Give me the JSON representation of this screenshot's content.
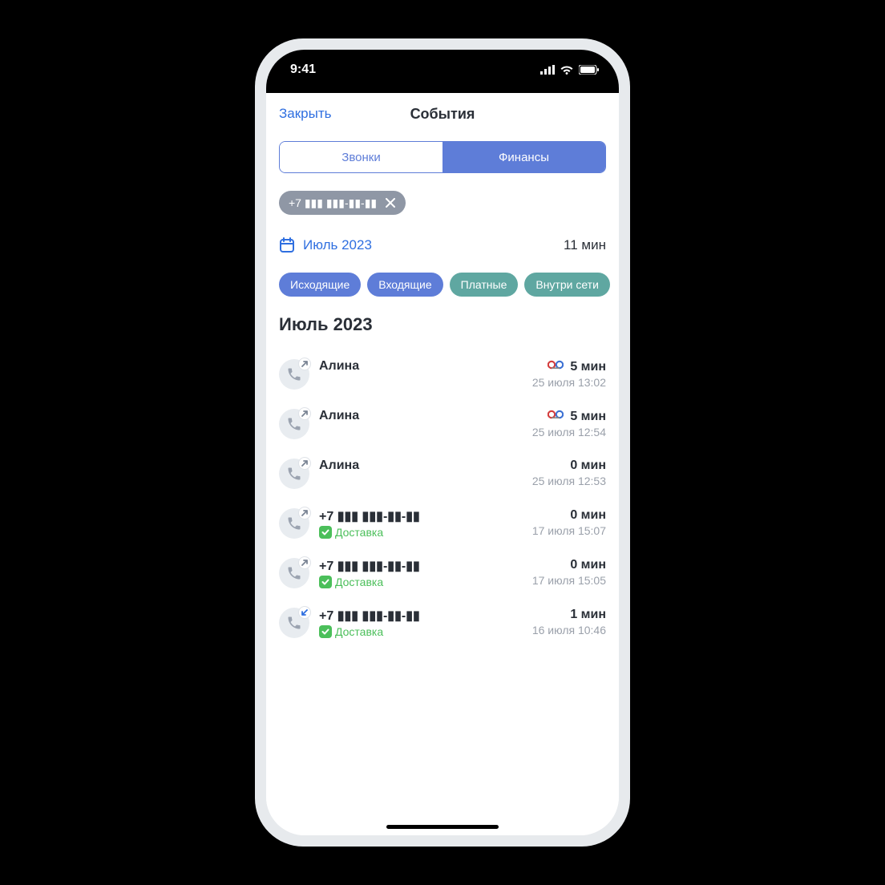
{
  "status": {
    "time": "9:41"
  },
  "header": {
    "close": "Закрыть",
    "title": "События"
  },
  "segmented": {
    "tab1": "Звонки",
    "tab2": "Финансы"
  },
  "filter_chip": {
    "number": "+7 ▮▮▮ ▮▮▮-▮▮-▮▮"
  },
  "date": {
    "label": "Июль 2023",
    "total": "11 мин"
  },
  "chips": {
    "c1": "Исходящие",
    "c2": "Входящие",
    "c3": "Платные",
    "c4": "Внутри сети"
  },
  "section": {
    "title": "Июль 2023"
  },
  "calls": [
    {
      "name": "Алина",
      "dir": "out",
      "duration": "5 мин",
      "ts": "25 июля 13:02",
      "voicemail": true,
      "sub": null
    },
    {
      "name": "Алина",
      "dir": "out",
      "duration": "5 мин",
      "ts": "25 июля 12:54",
      "voicemail": true,
      "sub": null
    },
    {
      "name": "Алина",
      "dir": "out",
      "duration": "0 мин",
      "ts": "25 июля 12:53",
      "voicemail": false,
      "sub": null
    },
    {
      "name": "+7 ▮▮▮ ▮▮▮-▮▮-▮▮",
      "dir": "out",
      "duration": "0 мин",
      "ts": "17 июля 15:07",
      "voicemail": false,
      "sub": "Доставка"
    },
    {
      "name": "+7 ▮▮▮ ▮▮▮-▮▮-▮▮",
      "dir": "out",
      "duration": "0 мин",
      "ts": "17 июля 15:05",
      "voicemail": false,
      "sub": "Доставка"
    },
    {
      "name": "+7 ▮▮▮ ▮▮▮-▮▮-▮▮",
      "dir": "in",
      "duration": "1 мин",
      "ts": "16 июля 10:46",
      "voicemail": false,
      "sub": "Доставка"
    }
  ]
}
